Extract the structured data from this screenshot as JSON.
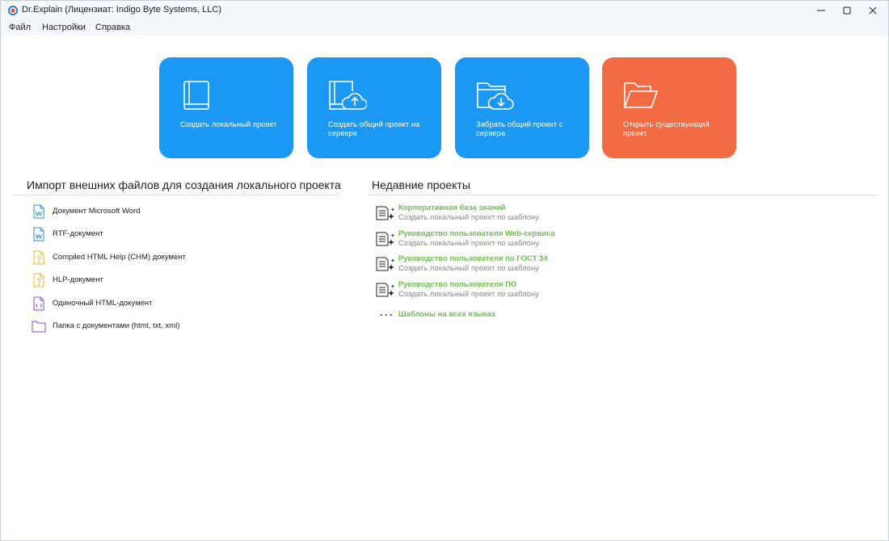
{
  "window": {
    "title": "Dr.Explain (Лицензиат: Indigo Byte Systems, LLC)"
  },
  "menu": {
    "items": [
      "Файл",
      "Настройки",
      "Справка"
    ]
  },
  "tiles": [
    {
      "label": "Создать локальный проект",
      "icon": "book-icon",
      "color": "#1a98f3"
    },
    {
      "label": "Создать общий проект на сервере",
      "icon": "book-cloud-upload-icon",
      "color": "#1a98f3"
    },
    {
      "label": "Забрать общий проект с сервера",
      "icon": "folder-cloud-download-icon",
      "color": "#1a98f3"
    },
    {
      "label": "Открыть существующий проект",
      "icon": "open-folder-icon",
      "color": "#f26b43"
    }
  ],
  "import": {
    "title": "Импорт внешних файлов для создания локального проекта",
    "items": [
      {
        "label": "Документ Microsoft Word",
        "icon": "word-doc-icon"
      },
      {
        "label": "RTF-документ",
        "icon": "rtf-doc-icon"
      },
      {
        "label": "Compiled HTML Help (CHM) документ",
        "icon": "chm-doc-icon"
      },
      {
        "label": "HLP-документ",
        "icon": "hlp-doc-icon"
      },
      {
        "label": "Одиночный HTML-документ",
        "icon": "html-doc-icon"
      },
      {
        "label": "Папка с документами (html, txt, xml)",
        "icon": "folder-icon"
      }
    ]
  },
  "recent": {
    "title": "Недавние проекты",
    "items": [
      {
        "name": "Корпоративная база знаний",
        "desc": "Создать локальный проект по шаблону"
      },
      {
        "name": "Руководство пользователя Web-сервиса",
        "desc": "Создать локальный проект по шаблону"
      },
      {
        "name": "Руководство пользователя по ГОСТ 34",
        "desc": "Создать локальный проект по шаблону"
      },
      {
        "name": "Руководство пользователя ПО",
        "desc": "Создать локальный проект по шаблону"
      }
    ],
    "more": {
      "dots": "···",
      "label": "Шаблоны на всех языках"
    }
  },
  "colors": {
    "accent_blue": "#1a98f3",
    "accent_orange": "#f26b43",
    "link_green": "#6bbf4e"
  }
}
